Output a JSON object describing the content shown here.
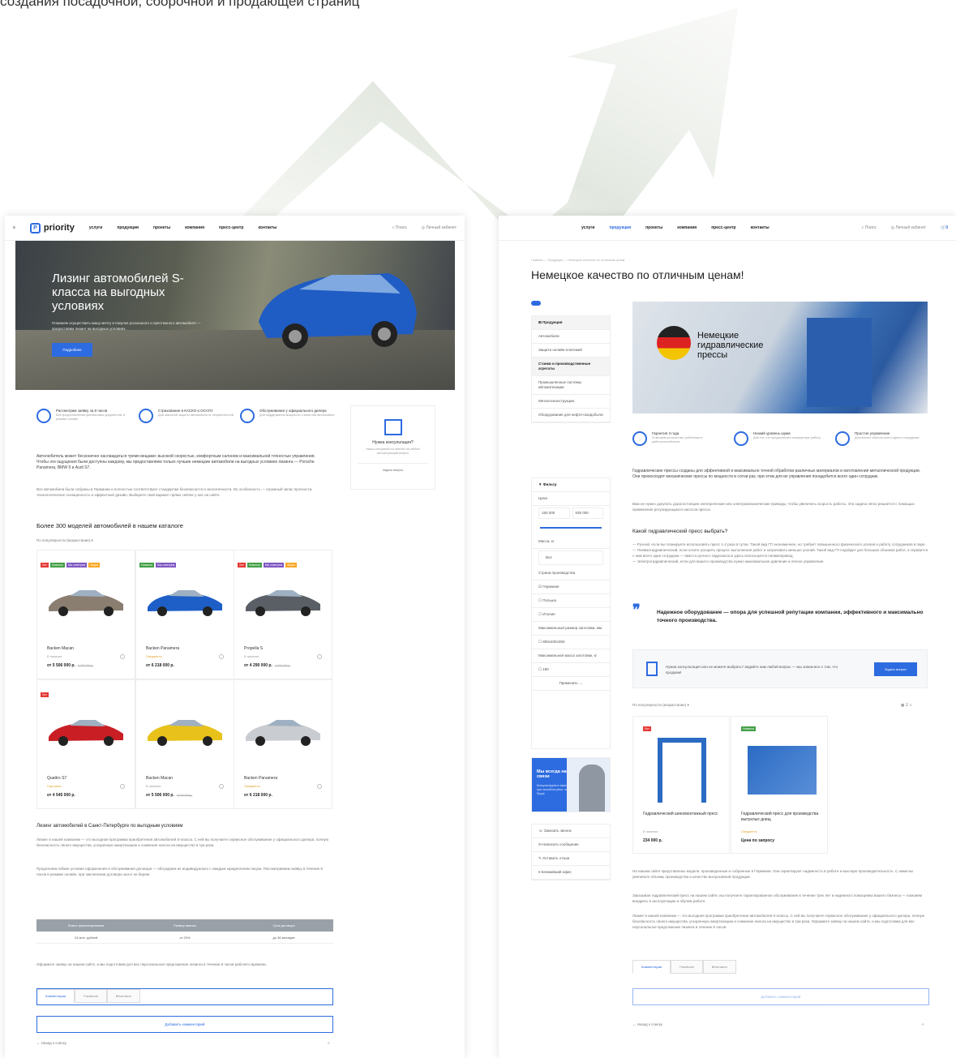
{
  "top_caption": "создания посадочной, сборочной и продающей страниц",
  "left": {
    "nav": {
      "logo": "priority",
      "items": [
        "услуги",
        "продукция",
        "проекты",
        "компания",
        "пресс-центр",
        "контакты"
      ],
      "search": "Поиск",
      "cabinet": "Личный кабинет"
    },
    "hero": {
      "title": "Лизинг автомобилей S-класса на выгодных условиях",
      "text": "Поможем осуществить вашу мечту в покупке роскошного и престижного автомобиля — предоставим лизинг на выгодных условиях.",
      "button": "Подробнее"
    },
    "features": [
      {
        "title": "Рассмотрим заявку за 8 часов",
        "desc": "Без предоставления финансовых документов, в режиме онлайн"
      },
      {
        "title": "Страхование в КАСКО и ОСАГО",
        "desc": "Для законной защиты автомобиля от неприятностей"
      },
      {
        "title": "Обслуживание у официального дилера",
        "desc": "Для поддержания мощности и качества автомобиля"
      }
    ],
    "consult": {
      "title": "Нужна консультация?",
      "text": "Наши специалисты ответят на любой интересующий вопрос",
      "button": "Задать вопрос"
    },
    "intro1": "Автолюбитель может бесконечно наслаждаться тремя вещами: высокой скоростью, комфортным салоном и максимальной точностью управления. Чтобы эти ощущения были доступны каждому, мы предоставляем только лучшие немецкие автомобили на выгодных условиях лизинга — Porsche Panamera, BMW 5 и Audi S7.",
    "intro2": "Все автомобили были собраны в Германии и полностью соответствуют стандартам безопасности и экологичности. Их особенность — огромный запас прочности, технологическое оснащенность и эффектный дизайн. Выберите свой вариант прямо сейчас у нас на сайте.",
    "catalog_title": "Более 300 моделей автомобилей в нашем каталоге",
    "sort": "По популярности (возрастание)",
    "cars": [
      {
        "name": "Backen Macan",
        "status": "В наличии",
        "price": "от 5 506 000 р.",
        "old": "5 700 000 р.",
        "tags": [
          "Хит",
          "Новинка",
          "Мы советуем",
          "Акция"
        ],
        "color": "#8a7e70"
      },
      {
        "name": "Backen Panamera",
        "status": "Ожидается",
        "price": "от 6 218 000 р.",
        "old": "",
        "tags": [
          "Новинка",
          "Мы советуем"
        ],
        "color": "#1e5fc7"
      },
      {
        "name": "Propella S",
        "status": "В наличии",
        "price": "от 4 290 000 р.",
        "old": "4 700 000 р.",
        "tags": [
          "Хит",
          "Новинка",
          "Мы советуем",
          "Акция"
        ],
        "color": "#5a5f66"
      },
      {
        "name": "Quattro S7",
        "status": "Под заказ",
        "price": "от 4 545 000 р.",
        "old": "",
        "tags": [
          "Хит"
        ],
        "color": "#c81e24"
      },
      {
        "name": "Backen Macan",
        "status": "В наличии",
        "price": "от 5 506 000 р.",
        "old": "5 700 000 р.",
        "tags": [],
        "color": "#e8c21a"
      },
      {
        "name": "Backen Panamera",
        "status": "Ожидается",
        "price": "от 6 218 000 р.",
        "old": "",
        "tags": [],
        "color": "#c9ccd0"
      }
    ],
    "lease_title": "Лизинг автомобилей в Санкт-Петербурге по выгодным условиям",
    "lease1": "Лизинг в нашей компании — это выгодная программа приобретения автомобилей S-класса. С ней вы получаете сервисное обслуживание у официального дилера, полную безопасность своего имущества, ускоренную амортизацию и снижение налога на имущество в три раза.",
    "lease2": "Предлагаем гибкие условия оформления и обслуживания договора — обсуждаем их индивидуально с каждым юридическим лицом. Рассматриваем заявку в течение 8 часов в режиме онлайн, при заключении договора залог не берем.",
    "table": {
      "head": [
        "Лимит финансирования",
        "Размер аванса",
        "Срок договора"
      ],
      "row": [
        "24 млн. рублей",
        "от 20%",
        "до 36 месяцев"
      ]
    },
    "outro": "Оформите заявку на нашем сайте, и мы подготовим для вас персональное предложение лизинга в течение 8 часов рабочего времени.",
    "tabs": [
      "Комментарии",
      "Facebook",
      "ВКонтакте"
    ],
    "add_comment": "Добавить комментарий",
    "back": "Назад к списку"
  },
  "right": {
    "nav": {
      "items": [
        "услуги",
        "продукция",
        "проекты",
        "компания",
        "пресс-центр",
        "контакты"
      ],
      "search": "Поиск",
      "cabinet": "Личный кабинет",
      "cart_count": "0"
    },
    "breadcrumb": "Главная — Продукция — Немецкое качество по отличным ценам",
    "title": "Немецкое качество по отличным ценам!",
    "menu_title": "Продукция",
    "menu": [
      "Автомобили",
      "Защита онлайн-платежей",
      "Станки и производственные агрегаты",
      "Промышленные системы автоматизации",
      "Металлоконструкции",
      "Оборудование для нефте-газодобычи"
    ],
    "filter_title": "Фильтр",
    "filter": {
      "price_label": "Цена",
      "min": "150 000",
      "max": "635 000",
      "mass_label": "Масса, кг",
      "mass_value": "Все",
      "country_label": "Страна производства",
      "countries": [
        "Германия",
        "Польша",
        "Италия"
      ],
      "size_label": "Максимальный размер заготовки, мм",
      "size_opt": "800х400х350",
      "weight_label": "Максимальная масса заготовки, кг",
      "weight_opt": "180",
      "apply": "Применить"
    },
    "contact_title": "Мы всегда на связи",
    "contact_text": "Консультируем в офисе, при личной встрече, по Skype",
    "contacts": [
      "Заказать звонок",
      "Написать сообщение",
      "Оставить отзыв",
      "Ближайший офис"
    ],
    "banner": "Немецкие гидравлические прессы",
    "features": [
      {
        "title": "Гарантия 3 года",
        "desc": "Отвечаем за качество, работника в работоспособности"
      },
      {
        "title": "Низкий уровень шума",
        "desc": "Для тех, кто предпочитает комфортную работу"
      },
      {
        "title": "Простое управление",
        "desc": "Достаточно обучить всего одного сотрудника"
      }
    ],
    "p1": "Гидравлические прессы созданы для эффективной и максимально точной обработки различных материалов и изготовления металлической продукции. Они превосходят механические прессы по мощности в сотни раз, при этом для их управления понадобится всего один сотрудник.",
    "p2": "Вам не нужно докупать дорогостоящие электрические или электромеханические приводы, чтобы увеличить скорость работы. Эта задача легко решается с помощью применения регулирующихся насосов пресса.",
    "sub": "Какой гидравлический пресс выбрать?",
    "list": [
      "Ручной, если вы планируете использовать пресс 1-2 раза в сутки. Такой вид ГП экономичнее, но требует повышенного физического усилия и работу сотрудников в паре.",
      "Пневмогидравлический, если хотите ускорить процесс выполнения работ и затрачивать меньше усилий. Такой вид ГП подойдет для больших объемов работ, а справится с ним всего один сотрудник — вместо ручного гидронасоса здесь используется пневмопривод.",
      "Электрогидравлический, если для вашего производства нужно максимальное давление и легкое управление."
    ],
    "quote": "Надежное оборудование — опора для успешной репутации компании, эффективного и максимально точного производства.",
    "ask_text": "Нужна консультация или не можете выбрать? Задайте нам любой вопрос — мы знаем все о том, что продаем!",
    "ask_button": "Задать вопрос",
    "sort": "По популярности (возрастание)",
    "products": [
      {
        "name": "Гидравлический шиномонтажный пресс",
        "status": "В наличии",
        "price": "234 000 р.",
        "tag": "Хит"
      },
      {
        "name": "Гидравлический пресс для производства выпуклых днищ",
        "status": "Ожидается",
        "price": "Цена по запросу",
        "tag": "Новинка"
      }
    ],
    "t1": "На нашем сайте представлены модели, произведенные и собранные в Германии. Они гарантируют надежность в работе и высокую производительность. С ними вы увеличите объемы производства и качество выпускаемой продукции.",
    "t2": "Заказывая гидравлический пресс на нашем сайте, вы получаете гарантированное обслуживание в течение трех лет и надежного помощника вашего бизнеса — поможем внедрить в эксплуатацию и обучим работе.",
    "t3": "Лизинг в нашей компании — это выгодная программа приобретения автомобилей S-класса. С ней вы получаете сервисное обслуживание у официального дилера, полную безопасность своего имущества, ускоренную амортизацию и снижение налога на имущество в три раза. Оформите заявку на нашем сайте, и мы подготовим для вас персональное предложение лизинга в течение 8 часов.",
    "tabs": [
      "Комментарии",
      "Facebook",
      "ВКонтакте"
    ],
    "add_comment": "Добавить комментарий",
    "back": "Назад к списку"
  }
}
